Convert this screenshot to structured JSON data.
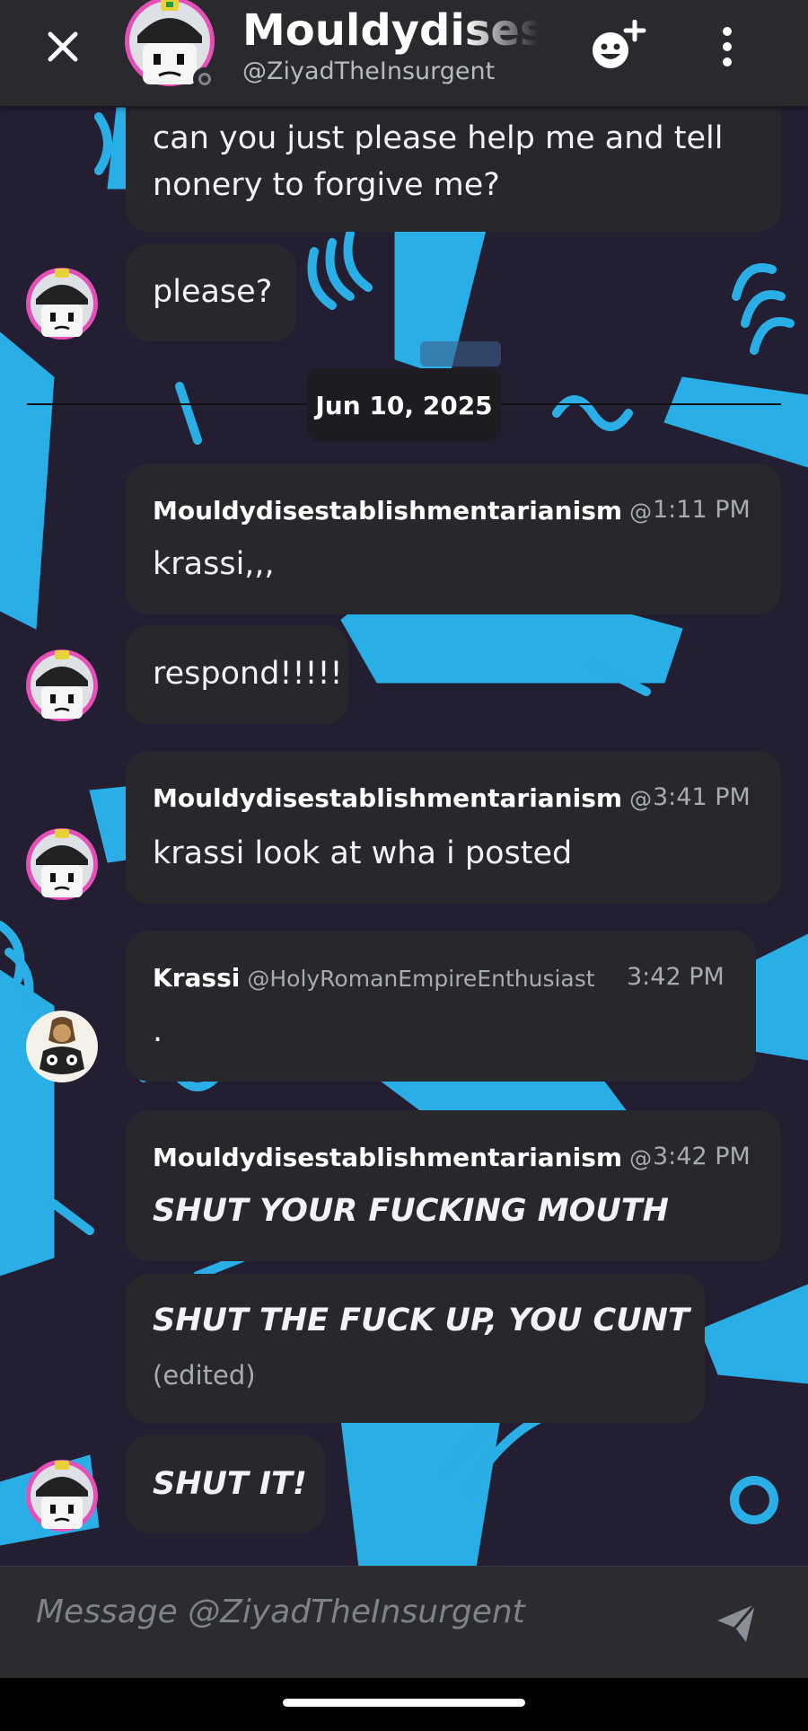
{
  "header": {
    "title": "Mouldydisestablishmentarianism",
    "subtitle": "@ZiyadTheInsurgent"
  },
  "messages": [
    {
      "text": "can you just please help me and tell",
      "text2": "nonery to forgive me?"
    },
    {
      "text": "please?"
    },
    {
      "author": "Mouldydisestablishmentarianism",
      "handle": "@",
      "time": "1:11 PM",
      "text": "krassi,,,"
    },
    {
      "text": "respond!!!!!"
    },
    {
      "author": "Mouldydisestablishmentarianism",
      "handle": "@",
      "time": "3:41 PM",
      "text": "krassi look at wha i posted"
    },
    {
      "author": "Krassi",
      "handle": "@HolyRomanEmpireEnthusiast",
      "time": "3:42 PM",
      "text": "."
    },
    {
      "author": "Mouldydisestablishmentarianism",
      "handle": "@",
      "time": "3:42 PM",
      "text": "SHUT YOUR FUCKING MOUTH"
    },
    {
      "text": "SHUT THE FUCK UP, YOU CUNT",
      "edited": "(edited)"
    },
    {
      "text": "SHUT IT!"
    }
  ],
  "date_divider": "Jun 10, 2025",
  "composer": {
    "placeholder": "Message @ZiyadTheInsurgent"
  },
  "icons": {
    "close": "close-icon",
    "add_friend": "add-friend-icon",
    "more": "more-vertical-icon",
    "send": "send-icon"
  },
  "colors": {
    "background": "#241f33",
    "pattern": "#29aee6",
    "bubble": "#27272c",
    "header": "#29292e",
    "avatar_ring": "#d64fb7"
  }
}
